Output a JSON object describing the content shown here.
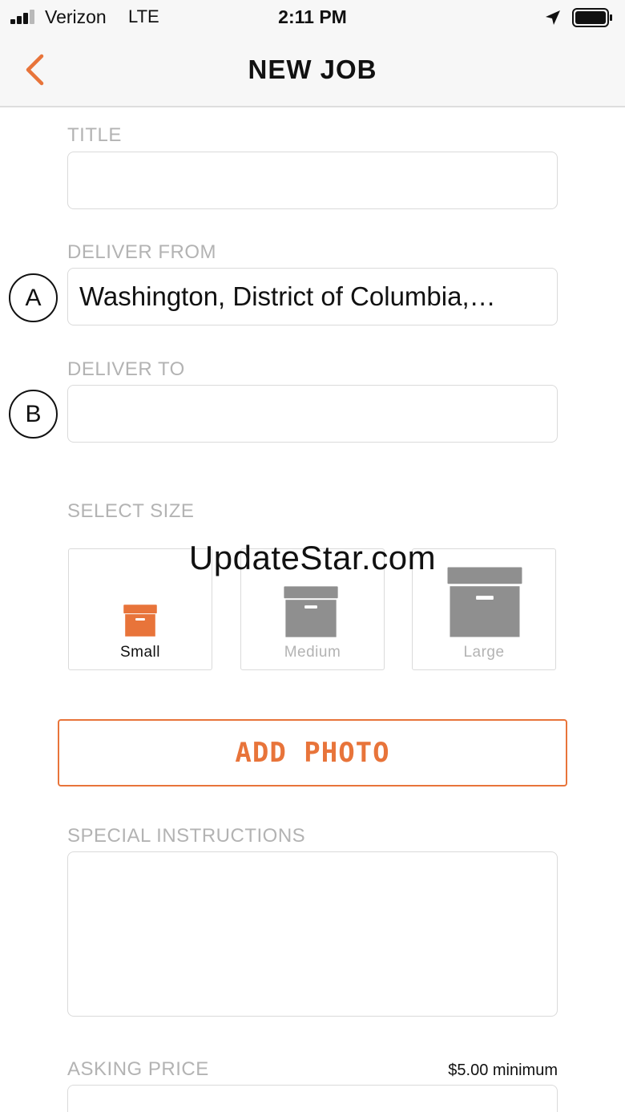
{
  "status_bar": {
    "carrier": "Verizon",
    "network": "LTE",
    "time": "2:11 PM"
  },
  "nav": {
    "title": "NEW JOB",
    "back_icon": "chevron-left-icon"
  },
  "form": {
    "title": {
      "label": "TITLE",
      "value": ""
    },
    "deliver_from": {
      "label": "DELIVER FROM",
      "marker": "A",
      "value": "Washington, District of Columbia,…"
    },
    "deliver_to": {
      "label": "DELIVER TO",
      "marker": "B",
      "value": ""
    },
    "size": {
      "label": "SELECT SIZE",
      "options": [
        {
          "label": "Small",
          "selected": true
        },
        {
          "label": "Medium",
          "selected": false
        },
        {
          "label": "Large",
          "selected": false
        }
      ]
    },
    "add_photo_label": "ADD PHOTO",
    "special_instructions": {
      "label": "SPECIAL INSTRUCTIONS",
      "value": ""
    },
    "asking_price": {
      "label": "ASKING PRICE",
      "note": "$5.00 minimum",
      "value": ""
    }
  },
  "watermark": "UpdateStar.com",
  "colors": {
    "accent": "#e8743a",
    "label_gray": "#b3b3b3",
    "icon_gray": "#8f8f8f",
    "border": "#dadada"
  }
}
